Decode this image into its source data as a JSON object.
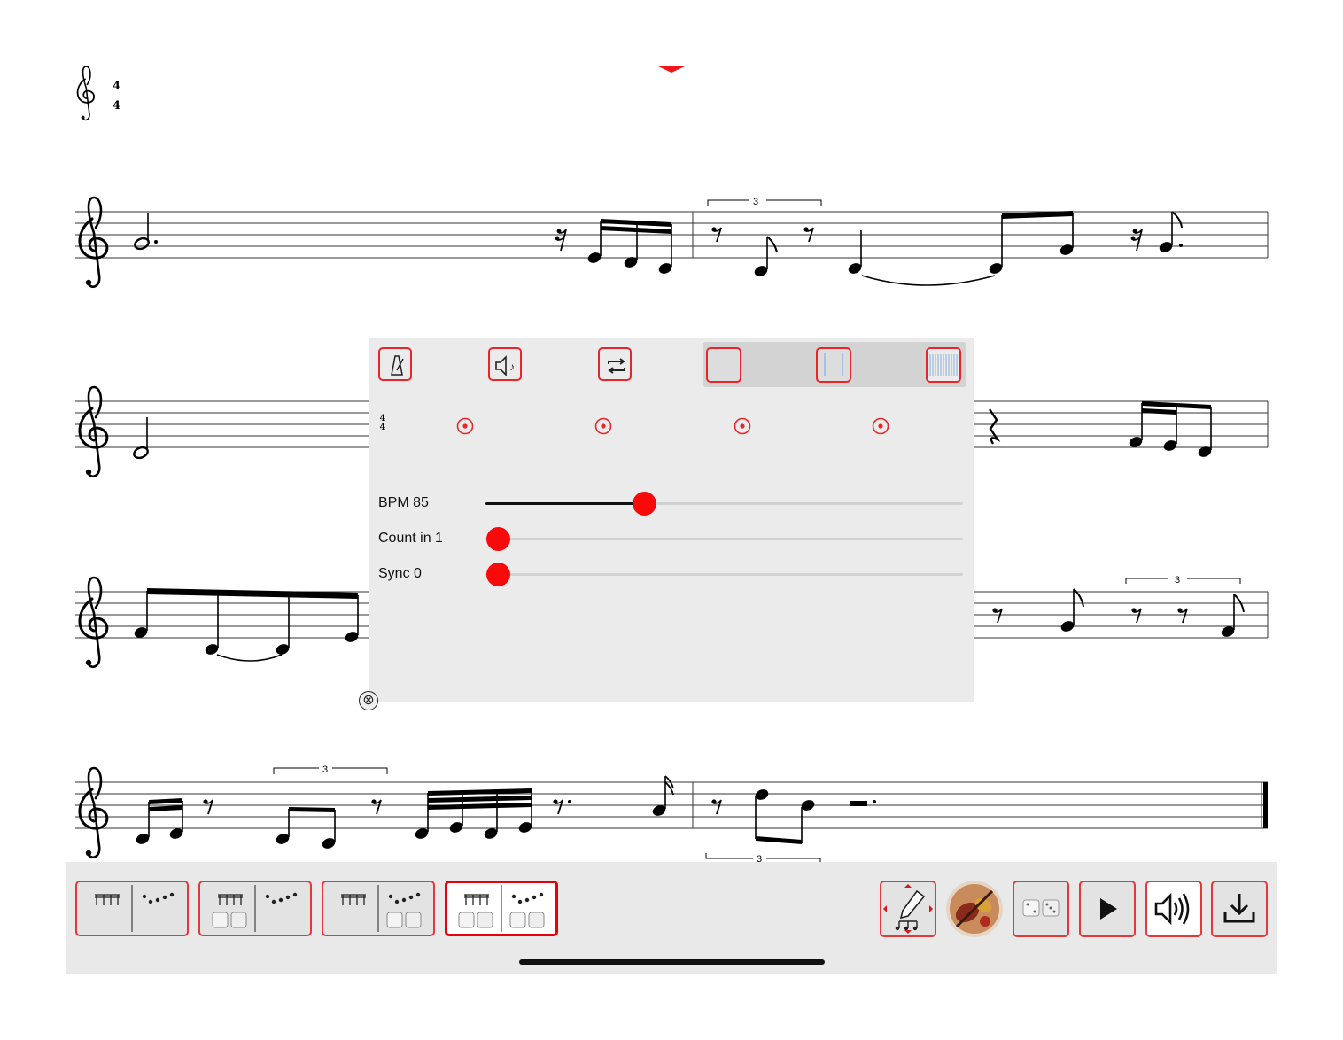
{
  "score": {
    "time_signature": {
      "top": "4",
      "bottom": "4"
    },
    "tuplet_labels": [
      "3",
      "3",
      "3",
      "3"
    ]
  },
  "panel": {
    "toolbar": {
      "metronome_icon": "metronome-icon",
      "sound_icon": "speaker-note-icon",
      "repeat_icon": "repeat-icon"
    },
    "beat_row": {
      "time_signature_top": "4",
      "time_signature_bottom": "4",
      "beats": 4
    },
    "sliders": [
      {
        "label": "BPM 85",
        "value_fraction": 0.33
      },
      {
        "label": "Count in 1",
        "value_fraction": 0.0
      },
      {
        "label": "Sync 0",
        "value_fraction": 0.0
      }
    ],
    "close_label": "⊗"
  },
  "bottom_toolbar": {
    "modes": [
      "rhythm-melody",
      "random-rhythm-melody",
      "rhythm-random-melody",
      "random-rhythm-random-melody"
    ],
    "selected_mode": 3,
    "tools": [
      "edit-notes-icon",
      "instrument-icon",
      "dice-icon",
      "play-icon",
      "volume-icon",
      "download-icon"
    ]
  },
  "colors": {
    "accent": "#e8262a",
    "slider_thumb": "#f80a0a",
    "panel_bg": "#ebebeb"
  }
}
